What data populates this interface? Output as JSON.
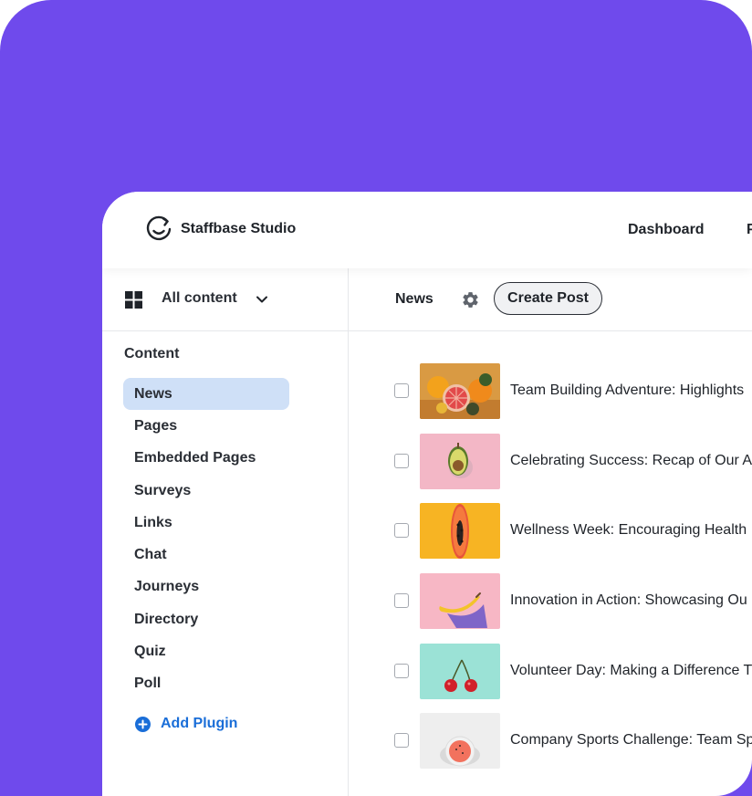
{
  "app": {
    "name": "Staffbase Studio"
  },
  "topnav": {
    "items": [
      "Dashboard",
      "P"
    ]
  },
  "sidebar": {
    "selector_label": "All content",
    "section_title": "Content",
    "items": [
      {
        "label": "News",
        "active": true
      },
      {
        "label": "Pages"
      },
      {
        "label": "Embedded Pages"
      },
      {
        "label": "Surveys"
      },
      {
        "label": "Links"
      },
      {
        "label": "Chat"
      },
      {
        "label": "Journeys"
      },
      {
        "label": "Directory"
      },
      {
        "label": "Quiz"
      },
      {
        "label": "Poll"
      }
    ],
    "add_plugin_label": "Add Plugin"
  },
  "main": {
    "title": "News",
    "create_button": "Create Post",
    "posts": [
      {
        "title": "Team Building Adventure: Highlights",
        "thumb": "oranges",
        "thumb_bg": "#d99a43"
      },
      {
        "title": "Celebrating Success: Recap of Our A",
        "thumb": "avocado",
        "thumb_bg": "#f3b7c6"
      },
      {
        "title": "Wellness Week: Encouraging Health",
        "thumb": "papaya",
        "thumb_bg": "#f7b423"
      },
      {
        "title": "Innovation in Action: Showcasing Ou",
        "thumb": "banana",
        "thumb_bg": "#f7b7c5"
      },
      {
        "title": "Volunteer Day: Making a Difference T",
        "thumb": "cherries",
        "thumb_bg": "#9be2d6"
      },
      {
        "title": "Company Sports Challenge: Team Sp",
        "thumb": "watermelon",
        "thumb_bg": "#eeeeee"
      }
    ]
  },
  "colors": {
    "background_purple": "#6f4aec",
    "active_item_bg": "#cfe0f7",
    "link_blue": "#1a6ed8"
  }
}
